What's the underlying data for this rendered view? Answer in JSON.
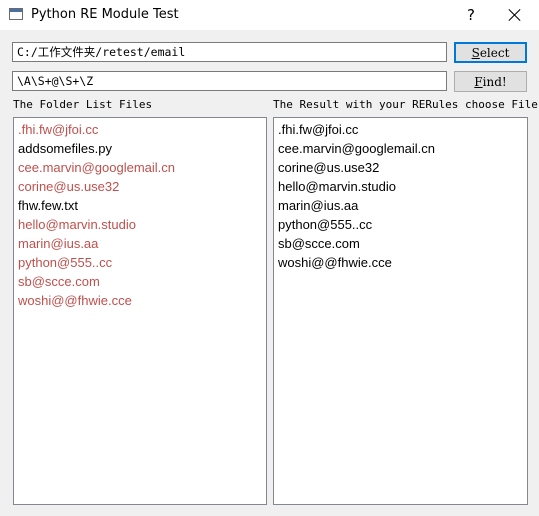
{
  "window": {
    "title": "Python RE Module Test",
    "help_label": "?",
    "icon": "app-window-icon"
  },
  "path_input": {
    "value": "C:/工作文件夹/retest/email"
  },
  "pattern_input": {
    "value": "\\A\\S+@\\S+\\Z"
  },
  "select_button": {
    "label_prefix": "",
    "mnemonic": "S",
    "label_rest": "elect"
  },
  "find_button": {
    "mnemonic": "F",
    "label_rest": "ind!"
  },
  "left_panel": {
    "header": "The Folder List Files",
    "items": [
      {
        "text": ".fhi.fw@jfoi.cc",
        "match": true
      },
      {
        "text": "addsomefiles.py",
        "match": false
      },
      {
        "text": "cee.marvin@googlemail.cn",
        "match": true
      },
      {
        "text": "corine@us.use32",
        "match": true
      },
      {
        "text": "fhw.few.txt",
        "match": false
      },
      {
        "text": "hello@marvin.studio",
        "match": true
      },
      {
        "text": "marin@ius.aa",
        "match": true
      },
      {
        "text": "python@555..cc",
        "match": true
      },
      {
        "text": "sb@scce.com",
        "match": true
      },
      {
        "text": "woshi@@fhwie.cce",
        "match": true
      }
    ]
  },
  "right_panel": {
    "header": "The Result with your RERules choose Files",
    "items": [
      ".fhi.fw@jfoi.cc",
      "cee.marvin@googlemail.cn",
      "corine@us.use32",
      "hello@marvin.studio",
      "marin@ius.aa",
      "python@555..cc",
      "sb@scce.com",
      "woshi@@fhwie.cce"
    ]
  },
  "colors": {
    "match": "#c0504d",
    "normal": "#000000",
    "focus_border": "#0078d7"
  }
}
